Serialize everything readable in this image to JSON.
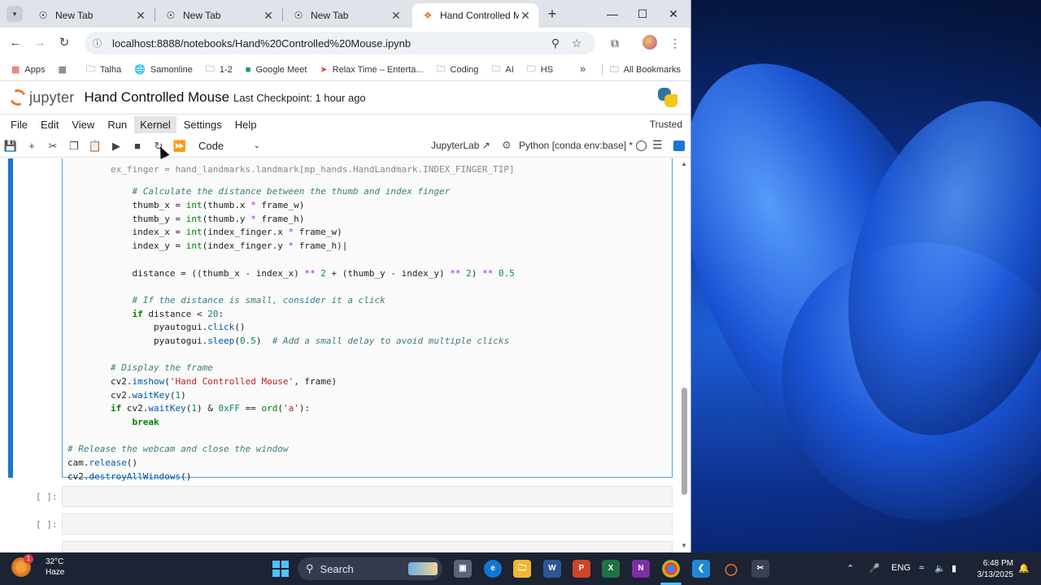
{
  "browser": {
    "tabs": [
      {
        "title": "New Tab",
        "active": false
      },
      {
        "title": "New Tab",
        "active": false
      },
      {
        "title": "New Tab",
        "active": false
      },
      {
        "title": "Hand Controlled Mou",
        "active": true
      }
    ],
    "url": "localhost:8888/notebooks/Hand%20Controlled%20Mouse.ipynb",
    "bookmarks": [
      "Apps",
      "Talha",
      "Samonline",
      "1-2",
      "Google Meet",
      "Relax Time – Enterta...",
      "Coding",
      "AI",
      "HS"
    ],
    "all_bookmarks": "All Bookmarks"
  },
  "jupyter": {
    "logo_text": "jupyter",
    "notebook_title": "Hand Controlled Mouse",
    "checkpoint": "Last Checkpoint: 1 hour ago",
    "menu": [
      "File",
      "Edit",
      "View",
      "Run",
      "Kernel",
      "Settings",
      "Help"
    ],
    "active_menu": "Kernel",
    "trusted": "Trusted",
    "cell_type": "Code",
    "jupyterlab_link": "JupyterLab",
    "kernel_name": "Python [conda env:base] *",
    "empty_prompts": [
      "[ ]:",
      "[ ]:"
    ]
  },
  "taskbar": {
    "temperature": "32°C",
    "weather": "Haze",
    "weather_badge": "1",
    "search": "Search",
    "language": "ENG",
    "time": "6:48 PM",
    "date": "3/13/2025"
  },
  "colors": {
    "jupyter_orange": "#f37626",
    "selected_cell": "#1976d2",
    "taskbar": "#1c2333"
  }
}
